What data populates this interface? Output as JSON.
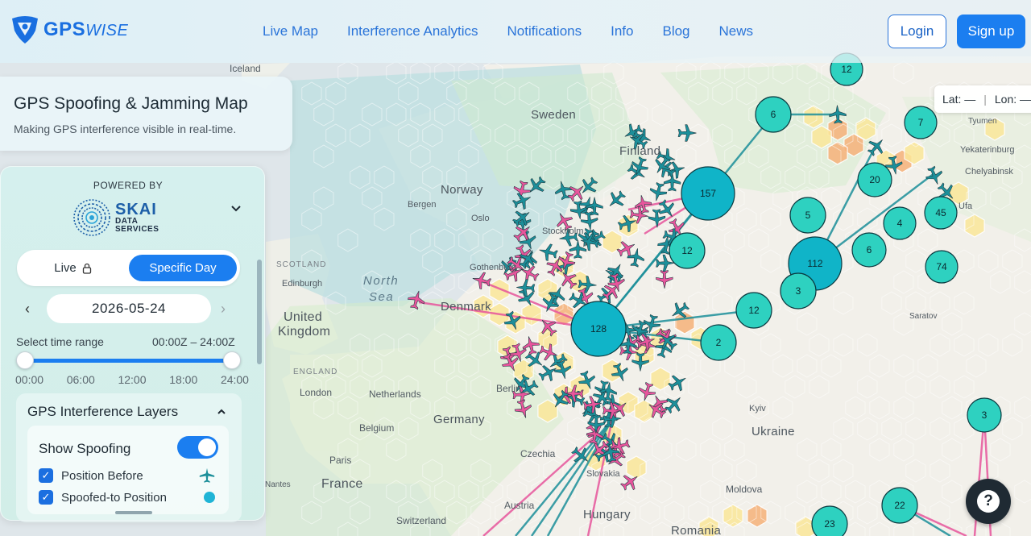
{
  "header": {
    "brand_main": "GPS",
    "brand_suffix": "WISE",
    "nav": [
      "Live Map",
      "Interference Analytics",
      "Notifications",
      "Info",
      "Blog",
      "News"
    ],
    "login": "Login",
    "signup": "Sign up"
  },
  "title_card": {
    "title": "GPS Spoofing & Jamming Map",
    "subtitle": "Making GPS interference visible in real-time."
  },
  "panel": {
    "powered_by": "POWERED BY",
    "partner_name": "SKAI",
    "partner_sub1": "DATA",
    "partner_sub2": "SERVICES",
    "mode_live": "Live",
    "mode_day": "Specific Day",
    "date": "2026-05-24",
    "range_label": "Select time range",
    "range_value": "00:00Z – 24:00Z",
    "ticks": [
      "00:00",
      "06:00",
      "12:00",
      "18:00",
      "24:00"
    ],
    "range_start_fraction": 0,
    "range_end_fraction": 1,
    "layers_title": "GPS Interference Layers",
    "show_spoofing": "Show Spoofing",
    "show_spoofing_on": true,
    "checkbox_1": "Position Before",
    "checkbox_2": "Spoofed-to Position"
  },
  "latlon": {
    "lat": "Lat: —",
    "lon": "Lon: —"
  },
  "map": {
    "labels": [
      {
        "text": "Iceland",
        "kind": "city"
      },
      {
        "text": "Sweden",
        "kind": "country"
      },
      {
        "text": "Finland",
        "kind": "country"
      },
      {
        "text": "Norway",
        "kind": "country"
      },
      {
        "text": "Bergen",
        "kind": "city"
      },
      {
        "text": "Oslo",
        "kind": "city"
      },
      {
        "text": "Stockholm",
        "kind": "city"
      },
      {
        "text": "Gothenburg",
        "kind": "city"
      },
      {
        "text": "SCOTLAND",
        "kind": "region"
      },
      {
        "text": "Edinburgh",
        "kind": "city"
      },
      {
        "text": "North",
        "kind": "sea"
      },
      {
        "text": "Sea",
        "kind": "sea"
      },
      {
        "text": "Denmark",
        "kind": "country"
      },
      {
        "text": "United",
        "kind": "country"
      },
      {
        "text": "Kingdom",
        "kind": "country"
      },
      {
        "text": "ENGLAND",
        "kind": "region"
      },
      {
        "text": "London",
        "kind": "city"
      },
      {
        "text": "Netherlands",
        "kind": "city"
      },
      {
        "text": "Berlin",
        "kind": "city"
      },
      {
        "text": "Germany",
        "kind": "country"
      },
      {
        "text": "Belgium",
        "kind": "city"
      },
      {
        "text": "Czechia",
        "kind": "city"
      },
      {
        "text": "Paris",
        "kind": "city"
      },
      {
        "text": "France",
        "kind": "country"
      },
      {
        "text": "Nantes",
        "kind": "city"
      },
      {
        "text": "Austria",
        "kind": "city"
      },
      {
        "text": "Switzerland",
        "kind": "city"
      },
      {
        "text": "Hungary",
        "kind": "country"
      },
      {
        "text": "Slovakia",
        "kind": "city"
      },
      {
        "text": "Kyiv",
        "kind": "city"
      },
      {
        "text": "Ukraine",
        "kind": "country"
      },
      {
        "text": "Moldova",
        "kind": "city"
      },
      {
        "text": "Romania",
        "kind": "country"
      },
      {
        "text": "Saratov",
        "kind": "city"
      },
      {
        "text": "Tyumen",
        "kind": "city"
      },
      {
        "text": "Yekaterinburg",
        "kind": "city"
      },
      {
        "text": "Chelyabinsk",
        "kind": "city"
      },
      {
        "text": "Ufa",
        "kind": "city"
      }
    ],
    "clusters": [
      "12",
      "6",
      "7",
      "157",
      "20",
      "5",
      "4",
      "45",
      "12",
      "112",
      "6",
      "74",
      "3",
      "12",
      "128",
      "2",
      "3",
      "22",
      "23"
    ]
  },
  "colors": {
    "accent": "#1b7ef0",
    "cluster": "#2ed1c0",
    "cluster_large": "#10b4c8",
    "spoof_pink": "#e7559c",
    "plane_teal": "#1c8f9a",
    "hex_yellow": "#fbe79a",
    "hex_orange": "#f6b27a",
    "hex_green": "#cfe9c5"
  }
}
